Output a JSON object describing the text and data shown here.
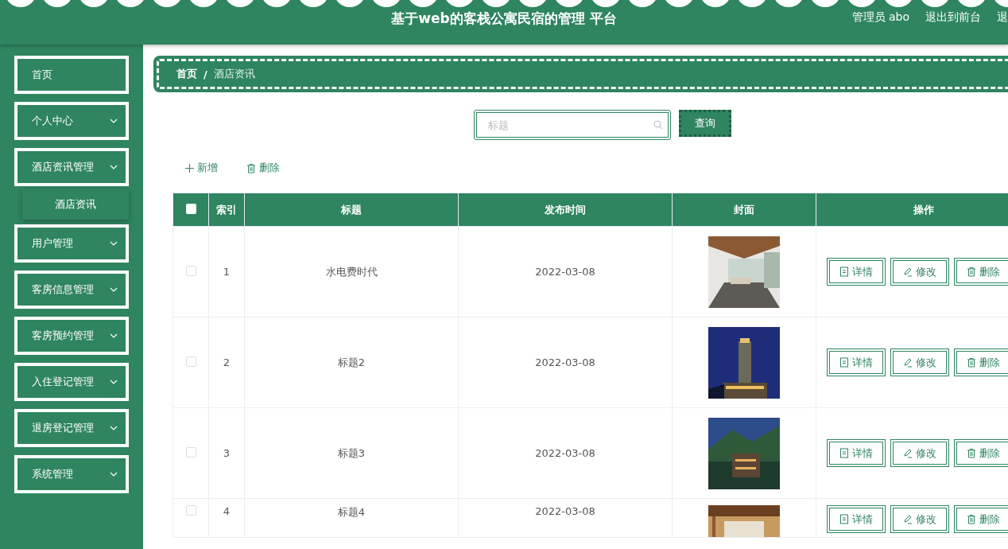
{
  "header": {
    "title": "基于web的客栈公寓民宿的管理 平台",
    "links": [
      "管理员 abo",
      "退出到前台",
      "退"
    ]
  },
  "sidebar": {
    "items": [
      {
        "label": "首页",
        "has_children": false
      },
      {
        "label": "个人中心",
        "has_children": true
      },
      {
        "label": "酒店资讯管理",
        "has_children": true,
        "children": [
          {
            "label": "酒店资讯",
            "selected": true
          }
        ]
      },
      {
        "label": "用户管理",
        "has_children": true
      },
      {
        "label": "客房信息管理",
        "has_children": true
      },
      {
        "label": "客房预约管理",
        "has_children": true
      },
      {
        "label": "入住登记管理",
        "has_children": true
      },
      {
        "label": "退房登记管理",
        "has_children": true
      },
      {
        "label": "系统管理",
        "has_children": true
      }
    ]
  },
  "breadcrumb": [
    "首页",
    "/",
    "酒店资讯"
  ],
  "search": {
    "placeholder": "标题",
    "button": "查询"
  },
  "actions": [
    "新增",
    "删除"
  ],
  "table": {
    "header_checked": false,
    "columns": [
      "索引",
      "标题",
      "发布时间",
      "封面",
      "操作"
    ],
    "rows": [
      {
        "checked": false,
        "index": "1",
        "title": "水电费时代",
        "date": "2022-03-08",
        "cover": {
          "kind": "picture"
        },
        "buttons": [
          "详情",
          "修改",
          "删除"
        ]
      },
      {
        "checked": false,
        "index": "2",
        "title": "标题2",
        "date": "2022-03-08",
        "cover": {
          "kind": "picture"
        },
        "buttons": [
          "详情",
          "修改",
          "删除"
        ]
      },
      {
        "checked": false,
        "index": "3",
        "title": "标题3",
        "date": "2022-03-08",
        "cover": {
          "kind": "picture"
        },
        "buttons": [
          "详情",
          "修改",
          "删除"
        ]
      },
      {
        "checked": false,
        "index": "4",
        "title": "标题4",
        "date": "2022-03-08",
        "cover": {
          "kind": "picture"
        },
        "buttons": [
          "详情",
          "修改",
          "删除"
        ]
      }
    ]
  }
}
